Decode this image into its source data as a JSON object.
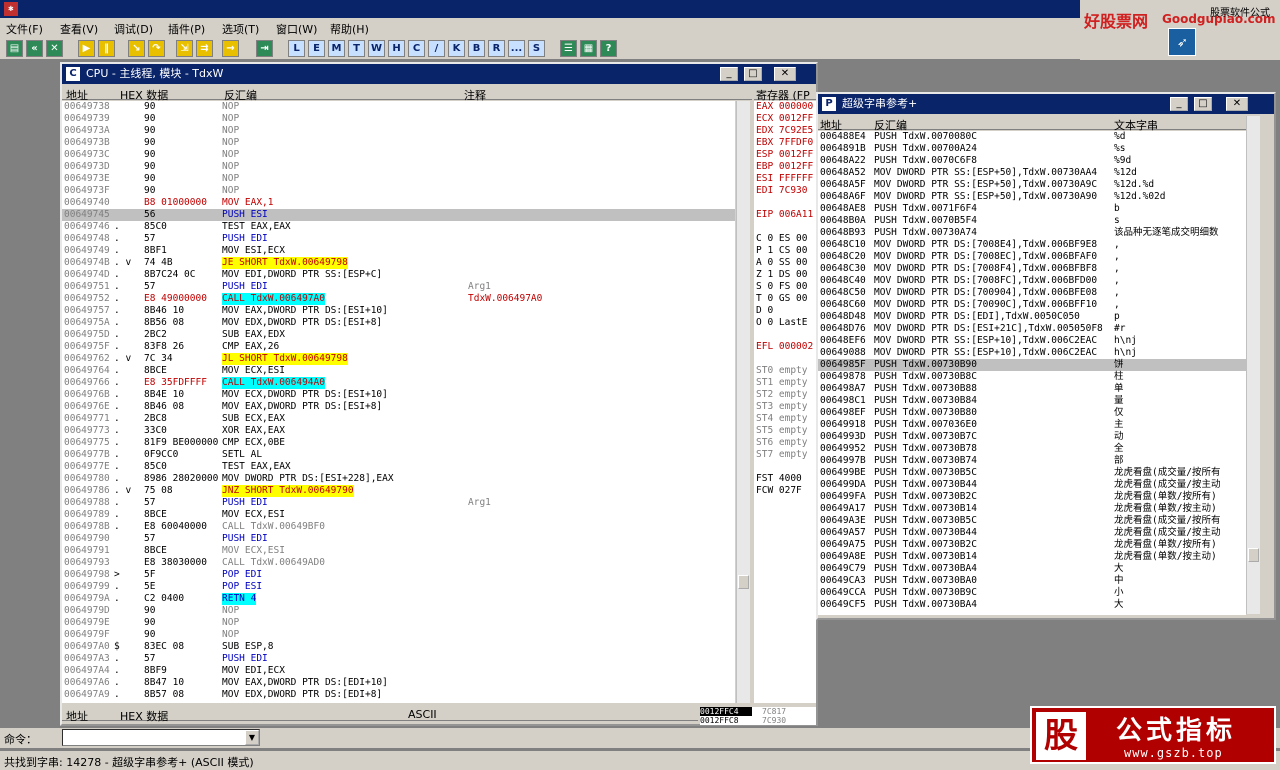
{
  "menu": {
    "file": "文件(F)",
    "view": "查看(V)",
    "debug": "调试(D)",
    "plugins": "插件(P)",
    "options": "选项(T)",
    "window": "窗口(W)",
    "help": "帮助(H)"
  },
  "toolbar_letters": [
    "L",
    "E",
    "M",
    "T",
    "W",
    "H",
    "C",
    "/",
    "K",
    "B",
    "R",
    "...",
    "S"
  ],
  "brand": {
    "site_cn": "好股票网",
    "site_en": "Goodgupiao.com",
    "tag": "股票软件公式"
  },
  "cpu": {
    "title": "CPU - 主线程, 模块 - TdxW",
    "headers": {
      "addr": "地址",
      "hex": "HEX 数据",
      "disasm": "反汇编",
      "comment": "注释"
    },
    "rows": [
      [
        "00649738",
        "",
        "90",
        "NOP",
        ""
      ],
      [
        "00649739",
        "",
        "90",
        "NOP",
        ""
      ],
      [
        "0064973A",
        "",
        "90",
        "NOP",
        ""
      ],
      [
        "0064973B",
        "",
        "90",
        "NOP",
        ""
      ],
      [
        "0064973C",
        "",
        "90",
        "NOP",
        ""
      ],
      [
        "0064973D",
        "",
        "90",
        "NOP",
        ""
      ],
      [
        "0064973E",
        "",
        "90",
        "NOP",
        ""
      ],
      [
        "0064973F",
        "",
        "90",
        "NOP",
        ""
      ],
      [
        "00649740",
        "",
        "B8 01000000",
        "MOV EAX,1",
        ""
      ],
      [
        "00649745",
        "",
        "56",
        "PUSH ESI",
        ""
      ],
      [
        "00649746",
        ".",
        "85C0",
        "TEST EAX,EAX",
        ""
      ],
      [
        "00649748",
        ".",
        "57",
        "PUSH EDI",
        ""
      ],
      [
        "00649749",
        ".",
        "8BF1",
        "MOV ESI,ECX",
        ""
      ],
      [
        "0064974B",
        ". v",
        "74 4B",
        "JE SHORT TdxW.00649798",
        ""
      ],
      [
        "0064974D",
        ".",
        "8B7C24 0C",
        "MOV EDI,DWORD PTR SS:[ESP+C]",
        ""
      ],
      [
        "00649751",
        ".",
        "57",
        "PUSH EDI",
        "Arg1"
      ],
      [
        "00649752",
        ".",
        "E8 49000000",
        "CALL TdxW.006497A0",
        "TdxW.006497A0"
      ],
      [
        "00649757",
        ".",
        "8B46 10",
        "MOV EAX,DWORD PTR DS:[ESI+10]",
        ""
      ],
      [
        "0064975A",
        ".",
        "8B56 08",
        "MOV EDX,DWORD PTR DS:[ESI+8]",
        ""
      ],
      [
        "0064975D",
        ".",
        "2BC2",
        "SUB EAX,EDX",
        ""
      ],
      [
        "0064975F",
        ".",
        "83F8 26",
        "CMP EAX,26",
        ""
      ],
      [
        "00649762",
        ". v",
        "7C 34",
        "JL SHORT TdxW.00649798",
        ""
      ],
      [
        "00649764",
        ".",
        "8BCE",
        "MOV ECX,ESI",
        ""
      ],
      [
        "00649766",
        ".",
        "E8 35FDFFFF",
        "CALL TdxW.006494A0",
        ""
      ],
      [
        "0064976B",
        ".",
        "8B4E 10",
        "MOV ECX,DWORD PTR DS:[ESI+10]",
        ""
      ],
      [
        "0064976E",
        ".",
        "8B46 08",
        "MOV EAX,DWORD PTR DS:[ESI+8]",
        ""
      ],
      [
        "00649771",
        ".",
        "2BC8",
        "SUB ECX,EAX",
        ""
      ],
      [
        "00649773",
        ".",
        "33C0",
        "XOR EAX,EAX",
        ""
      ],
      [
        "00649775",
        ".",
        "81F9 BE000000",
        "CMP ECX,0BE",
        ""
      ],
      [
        "0064977B",
        ".",
        "0F9CC0",
        "SETL AL",
        ""
      ],
      [
        "0064977E",
        ".",
        "85C0",
        "TEST EAX,EAX",
        ""
      ],
      [
        "00649780",
        ".",
        "8986 28020000",
        "MOV DWORD PTR DS:[ESI+228],EAX",
        ""
      ],
      [
        "00649786",
        ". v",
        "75 08",
        "JNZ SHORT TdxW.00649790",
        ""
      ],
      [
        "00649788",
        ".",
        "57",
        "PUSH EDI",
        "Arg1"
      ],
      [
        "00649789",
        ".",
        "8BCE",
        "MOV ECX,ESI",
        ""
      ],
      [
        "0064978B",
        ".",
        "E8 60040000",
        "CALL TdxW.00649BF0",
        ""
      ],
      [
        "00649790",
        "",
        "57",
        "PUSH EDI",
        ""
      ],
      [
        "00649791",
        "",
        "8BCE",
        "MOV ECX,ESI",
        ""
      ],
      [
        "00649793",
        "",
        "E8 38030000",
        "CALL TdxW.00649AD0",
        ""
      ],
      [
        "00649798",
        "> ",
        "5F",
        "POP EDI",
        ""
      ],
      [
        "00649799",
        ".",
        "5E",
        "POP ESI",
        ""
      ],
      [
        "0064979A",
        ".",
        "C2 0400",
        "RETN 4",
        ""
      ],
      [
        "0064979D",
        "",
        "90",
        "NOP",
        ""
      ],
      [
        "0064979E",
        "",
        "90",
        "NOP",
        ""
      ],
      [
        "0064979F",
        "",
        "90",
        "NOP",
        ""
      ],
      [
        "006497A0",
        "$",
        "83EC 08",
        "SUB ESP,8",
        ""
      ],
      [
        "006497A3",
        ".",
        "57",
        "PUSH EDI",
        ""
      ],
      [
        "006497A4",
        ".",
        "8BF9",
        "MOV EDI,ECX",
        ""
      ],
      [
        "006497A6",
        ".",
        "8B47 10",
        "MOV EAX,DWORD PTR DS:[EDI+10]",
        ""
      ],
      [
        "006497A9",
        ".",
        "8B57 08",
        "MOV EDX,DWORD PTR DS:[EDI+8]",
        ""
      ]
    ],
    "dump_headers": {
      "addr": "地址",
      "hex": "HEX 数据",
      "ascii": "ASCII"
    },
    "stack": [
      "0012FFC4",
      "0012FFC8"
    ],
    "stack_vals": [
      "7C817",
      "7C930"
    ]
  },
  "regs": {
    "header": "寄存器 (FP",
    "list": [
      "EAX 000000",
      "ECX 0012FF",
      "EDX 7C92E5",
      "EBX 7FFDF0",
      "ESP 0012FF",
      "EBP 0012FF",
      "ESI FFFFFF",
      "EDI 7C930",
      "",
      "EIP 006A11",
      "",
      "C 0  ES 00",
      "P 1  CS 00",
      "A 0  SS 00",
      "Z 1  DS 00",
      "S 0  FS 00",
      "T 0  GS 00",
      "D 0",
      "O 0  LastE",
      "",
      "EFL 000002",
      "",
      "ST0 empty",
      "ST1 empty",
      "ST2 empty",
      "ST3 empty",
      "ST4 empty",
      "ST5 empty",
      "ST6 empty",
      "ST7 empty",
      "",
      "FST 4000",
      "FCW 027F"
    ]
  },
  "strings": {
    "title": "超级字串参考+",
    "headers": {
      "addr": "地址",
      "disasm": "反汇编",
      "text": "文本字串"
    },
    "rows": [
      [
        "006488E4",
        "PUSH TdxW.0070080C",
        "%d"
      ],
      [
        "0064891B",
        "PUSH TdxW.00700A24",
        "%s"
      ],
      [
        "00648A22",
        "PUSH TdxW.0070C6F8",
        "%9d"
      ],
      [
        "00648A52",
        "MOV DWORD PTR SS:[ESP+50],TdxW.00730AA4",
        "%12d"
      ],
      [
        "00648A5F",
        "MOV DWORD PTR SS:[ESP+50],TdxW.00730A9C",
        "%12d.%d"
      ],
      [
        "00648A6F",
        "MOV DWORD PTR SS:[ESP+50],TdxW.00730A90",
        "%12d.%02d"
      ],
      [
        "00648AE8",
        "PUSH TdxW.0071F6F4",
        "b"
      ],
      [
        "00648B0A",
        "PUSH TdxW.0070B5F4",
        "s"
      ],
      [
        "00648B93",
        "PUSH TdxW.00730A74",
        "该品种无逐笔成交明细数"
      ],
      [
        "00648C10",
        "MOV DWORD PTR DS:[7008E4],TdxW.006BF9E8",
        ","
      ],
      [
        "00648C20",
        "MOV DWORD PTR DS:[7008EC],TdxW.006BFAF0",
        ","
      ],
      [
        "00648C30",
        "MOV DWORD PTR DS:[7008F4],TdxW.006BFBF8",
        ","
      ],
      [
        "00648C40",
        "MOV DWORD PTR DS:[7008FC],TdxW.006BFD00",
        ","
      ],
      [
        "00648C50",
        "MOV DWORD PTR DS:[700904],TdxW.006BFE08",
        ","
      ],
      [
        "00648C60",
        "MOV DWORD PTR DS:[70090C],TdxW.006BFF10",
        ","
      ],
      [
        "00648D48",
        "MOV DWORD PTR DS:[EDI],TdxW.0050C050",
        "p"
      ],
      [
        "00648D76",
        "MOV DWORD PTR DS:[ESI+21C],TdxW.005050F8",
        "#r"
      ],
      [
        "00648EF6",
        "MOV DWORD PTR SS:[ESP+10],TdxW.006C2EAC",
        "h\\nj"
      ],
      [
        "00649088",
        "MOV DWORD PTR SS:[ESP+10],TdxW.006C2EAC",
        "h\\nj"
      ],
      [
        "0064985F",
        "PUSH TdxW.00730B90",
        "饼"
      ],
      [
        "00649878",
        "PUSH TdxW.00730B8C",
        "柱"
      ],
      [
        "006498A7",
        "PUSH TdxW.00730B88",
        "单"
      ],
      [
        "006498C1",
        "PUSH TdxW.00730B84",
        "量"
      ],
      [
        "006498EF",
        "PUSH TdxW.00730B80",
        "仅"
      ],
      [
        "00649918",
        "PUSH TdxW.007036E0",
        "主"
      ],
      [
        "0064993D",
        "PUSH TdxW.00730B7C",
        "动"
      ],
      [
        "00649952",
        "PUSH TdxW.00730B78",
        "全"
      ],
      [
        "0064997B",
        "PUSH TdxW.00730B74",
        "部"
      ],
      [
        "006499BE",
        "PUSH TdxW.00730B5C",
        "龙虎看盘(成交量/按所有"
      ],
      [
        "006499DA",
        "PUSH TdxW.00730B44",
        "龙虎看盘(成交量/按主动"
      ],
      [
        "006499FA",
        "PUSH TdxW.00730B2C",
        "龙虎看盘(单数/按所有)"
      ],
      [
        "00649A17",
        "PUSH TdxW.00730B14",
        "龙虎看盘(单数/按主动)"
      ],
      [
        "00649A3E",
        "PUSH TdxW.00730B5C",
        "龙虎看盘(成交量/按所有"
      ],
      [
        "00649A57",
        "PUSH TdxW.00730B44",
        "龙虎看盘(成交量/按主动"
      ],
      [
        "00649A75",
        "PUSH TdxW.00730B2C",
        "龙虎看盘(单数/按所有)"
      ],
      [
        "00649A8E",
        "PUSH TdxW.00730B14",
        "龙虎看盘(单数/按主动)"
      ],
      [
        "00649C79",
        "PUSH TdxW.00730BA4",
        "大"
      ],
      [
        "00649CA3",
        "PUSH TdxW.00730BA0",
        "中"
      ],
      [
        "00649CCA",
        "PUSH TdxW.00730B9C",
        "小"
      ],
      [
        "00649CF5",
        "PUSH TdxW.00730BA4",
        "大"
      ]
    ]
  },
  "command": {
    "label": "命令："
  },
  "status": {
    "text": "共找到字串: 14278  - 超级字串参考+ (ASCII 模式)"
  },
  "ad": {
    "big": "股",
    "text": "公式指标",
    "url": "www.gszb.top"
  }
}
